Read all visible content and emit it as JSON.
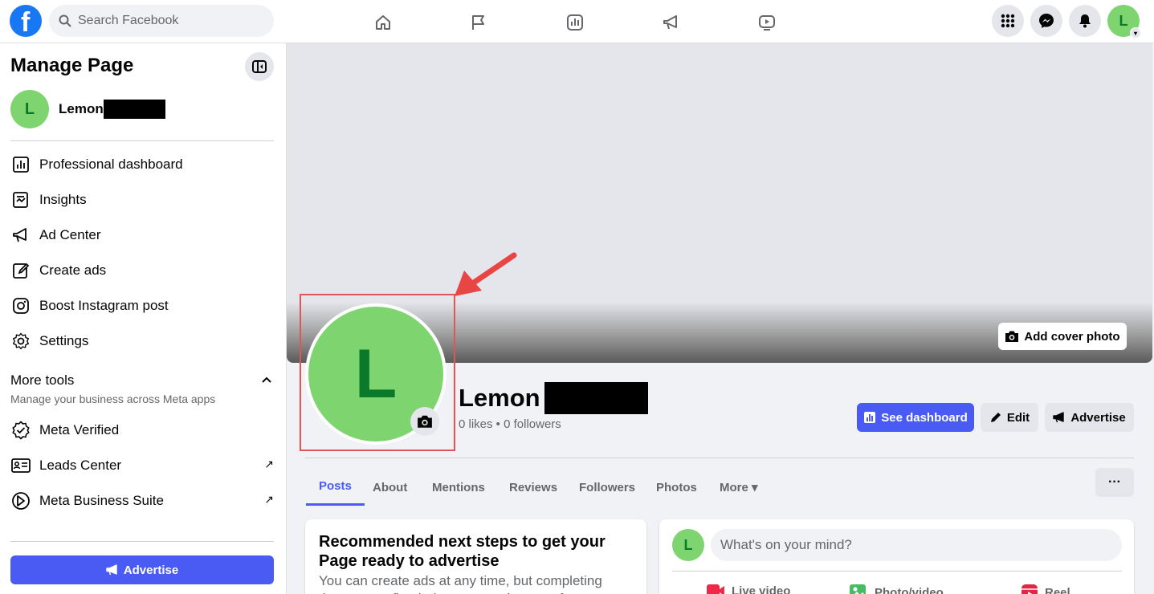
{
  "topbar": {
    "logo": "f",
    "search_placeholder": "Search Facebook",
    "nav_icons": [
      "home-icon",
      "flag-icon",
      "insights-icon",
      "megaphone-icon",
      "video-icon"
    ],
    "right_icons": [
      "apps-grid-icon",
      "messenger-icon",
      "bell-icon"
    ],
    "avatar_initial": "L"
  },
  "sidebar": {
    "title": "Manage Page",
    "page_avatar_initial": "L",
    "page_name": "Lemon",
    "items": [
      {
        "label": "Professional dashboard",
        "icon": "dashboard-icon"
      },
      {
        "label": "Insights",
        "icon": "insights-icon"
      },
      {
        "label": "Ad Center",
        "icon": "megaphone-icon"
      },
      {
        "label": "Create ads",
        "icon": "edit-icon"
      },
      {
        "label": "Boost Instagram post",
        "icon": "instagram-icon"
      },
      {
        "label": "Settings",
        "icon": "gear-icon"
      }
    ],
    "more_tools": {
      "title": "More tools",
      "subtitle": "Manage your business across Meta apps",
      "items": [
        {
          "label": "Meta Verified",
          "icon": "verified-icon"
        },
        {
          "label": "Leads Center",
          "icon": "leads-icon",
          "external": "↗"
        },
        {
          "label": "Meta Business Suite",
          "icon": "business-suite-icon",
          "external": "↗"
        }
      ]
    },
    "advertise_label": "Advertise"
  },
  "profile": {
    "add_cover_label": "Add cover photo",
    "avatar_initial": "L",
    "name": "Lemon",
    "stats": "0 likes • 0 followers",
    "buttons": {
      "see_dashboard": "See dashboard",
      "edit": "Edit",
      "advertise": "Advertise"
    },
    "tabs": [
      "Posts",
      "About",
      "Mentions",
      "Reviews",
      "Followers",
      "Photos",
      "More ▾"
    ],
    "more_dots": "···"
  },
  "recommend_card": {
    "title": "Recommended next steps to get your Page ready to advertise",
    "body": "You can create ads at any time, but completing these steps first helps you get the most from"
  },
  "composer": {
    "avatar_initial": "L",
    "placeholder": "What's on your mind?",
    "actions": [
      "Live video",
      "Photo/video",
      "Reel"
    ]
  },
  "colors": {
    "brand": "#1877f2",
    "accent": "#4a5bf4",
    "avatar_bg": "#7ed56f",
    "annotation": "#e05555"
  }
}
